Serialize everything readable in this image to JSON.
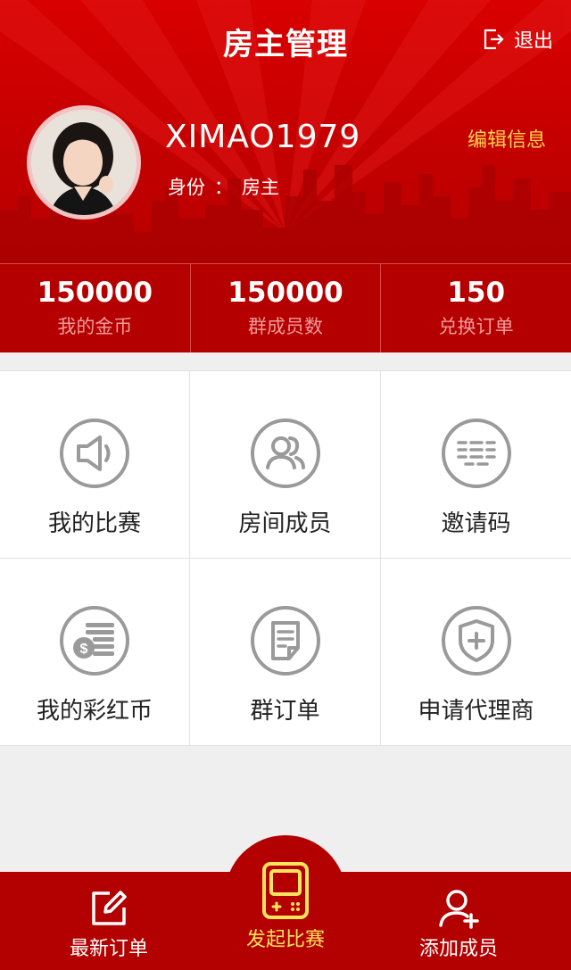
{
  "header": {
    "title": "房主管理",
    "logout_label": "退出",
    "username": "XIMAO1979",
    "identity_label": "身份",
    "identity_sep": "：",
    "identity_value": "房主",
    "edit_label": "编辑信息"
  },
  "stats": [
    {
      "value": "150000",
      "label": "我的金币"
    },
    {
      "value": "150000",
      "label": "群成员数"
    },
    {
      "value": "150",
      "label": "兑换订单"
    }
  ],
  "grid": [
    {
      "label": "我的比赛",
      "icon": "megaphone-icon"
    },
    {
      "label": "房间成员",
      "icon": "members-icon"
    },
    {
      "label": "邀请码",
      "icon": "code-list-icon"
    },
    {
      "label": "我的彩红币",
      "icon": "coins-icon"
    },
    {
      "label": "群订单",
      "icon": "document-icon"
    },
    {
      "label": "申请代理商",
      "icon": "shield-plus-icon"
    }
  ],
  "nav": {
    "left_label": "最新订单",
    "center_label": "发起比赛",
    "right_label": "添加成员"
  },
  "colors": {
    "primary_red": "#c40000",
    "dark_red": "#b30000",
    "accent_yellow": "#ffd34d",
    "icon_gray": "#9a9a9a"
  }
}
